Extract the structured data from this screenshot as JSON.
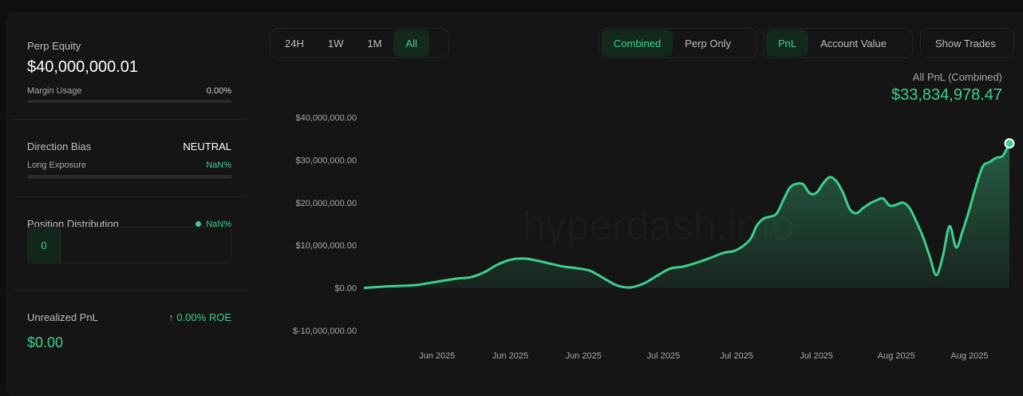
{
  "left": {
    "perp_equity_label": "Perp Equity",
    "perp_equity_value": "$40,000,000.01",
    "margin_usage_label": "Margin Usage",
    "margin_usage_value": "0.00%",
    "direction_bias_label": "Direction Bias",
    "direction_bias_value": "NEUTRAL",
    "long_exposure_label": "Long Exposure",
    "long_exposure_value": "NaN%",
    "position_distribution_label": "Position Distribution",
    "position_distribution_value": "NaN%",
    "distribution_count": "0",
    "unrealized_pnl_label": "Unrealized PnL",
    "roe_arrow": "↑",
    "roe_value": "0.00% ROE",
    "unrealized_pnl_value": "$0.00"
  },
  "toolbar": {
    "timeframes": [
      "24H",
      "1W",
      "1M",
      "All"
    ],
    "active_timeframe": "All",
    "scope": [
      "Combined",
      "Perp Only"
    ],
    "active_scope": "Combined",
    "metric": [
      "PnL",
      "Account Value"
    ],
    "active_metric": "PnL",
    "show_trades": "Show Trades"
  },
  "summary": {
    "title": "All PnL (Combined)",
    "value": "$33,834,978.47"
  },
  "watermark": "hyperdash.info",
  "colors": {
    "accent": "#3ecf8e",
    "background": "#151515"
  },
  "chart_data": {
    "type": "area",
    "series": [
      {
        "values": [
          [
            0,
            0.0
          ],
          [
            2,
            0.2
          ],
          [
            4,
            0.4
          ],
          [
            6,
            0.5
          ],
          [
            8,
            0.7
          ],
          [
            10,
            1.2
          ],
          [
            12,
            1.7
          ],
          [
            14,
            2.2
          ],
          [
            16,
            2.5
          ],
          [
            18,
            3.6
          ],
          [
            20,
            5.4
          ],
          [
            22,
            6.6
          ],
          [
            24,
            6.9
          ],
          [
            26,
            6.4
          ],
          [
            28,
            5.7
          ],
          [
            30,
            5.0
          ],
          [
            32,
            4.6
          ],
          [
            34,
            4.0
          ],
          [
            36,
            2.3
          ],
          [
            38,
            0.6
          ],
          [
            40,
            0.1
          ],
          [
            42,
            1.0
          ],
          [
            44,
            2.8
          ],
          [
            46,
            4.5
          ],
          [
            48,
            5.0
          ],
          [
            50,
            5.9
          ],
          [
            52,
            7.0
          ],
          [
            54,
            8.2
          ],
          [
            56,
            8.9
          ],
          [
            58,
            11.3
          ],
          [
            59,
            14.5
          ],
          [
            60,
            16.2
          ],
          [
            61,
            16.7
          ],
          [
            62,
            17.4
          ],
          [
            63,
            20.5
          ],
          [
            64,
            23.5
          ],
          [
            65,
            24.4
          ],
          [
            66,
            24.3
          ],
          [
            67,
            22.2
          ],
          [
            68,
            22.3
          ],
          [
            69,
            24.5
          ],
          [
            70,
            26.0
          ],
          [
            71,
            25.0
          ],
          [
            72,
            22.3
          ],
          [
            73,
            18.5
          ],
          [
            74,
            17.5
          ],
          [
            75,
            18.7
          ],
          [
            76,
            19.8
          ],
          [
            77,
            20.5
          ],
          [
            78,
            21.0
          ],
          [
            79,
            19.3
          ],
          [
            80,
            19.5
          ],
          [
            81,
            20.0
          ],
          [
            82,
            18.7
          ],
          [
            83,
            15.6
          ],
          [
            84,
            12.0
          ],
          [
            85,
            7.5
          ],
          [
            86,
            3.0
          ],
          [
            87,
            7.5
          ],
          [
            88,
            14.5
          ],
          [
            89,
            9.5
          ],
          [
            90,
            13.5
          ],
          [
            91,
            18.5
          ],
          [
            92,
            24.0
          ],
          [
            93,
            28.5
          ],
          [
            94,
            29.5
          ],
          [
            95,
            30.5
          ],
          [
            96,
            31.0
          ],
          [
            97,
            33.9
          ]
        ]
      }
    ],
    "x_tick_labels": [
      "Jun 2025",
      "Jun 2025",
      "Jun 2025",
      "Jul 2025",
      "Jul 2025",
      "Jul 2025",
      "Aug 2025",
      "Aug 2025"
    ],
    "x_tick_positions": [
      11,
      22,
      33,
      45,
      56,
      68,
      80,
      91
    ],
    "y_ticks": [
      40,
      30,
      20,
      10,
      0,
      -10
    ],
    "y_tick_labels": [
      "$40,000,000.00",
      "$30,000,000.00",
      "$20,000,000.00",
      "$10,000,000.00",
      "$0.00",
      "$-10,000,000.00"
    ],
    "ylim": [
      -10,
      40
    ],
    "xlim": [
      0,
      97
    ],
    "y_unit": "millions USD",
    "grid": false,
    "last_point_marker": true
  }
}
